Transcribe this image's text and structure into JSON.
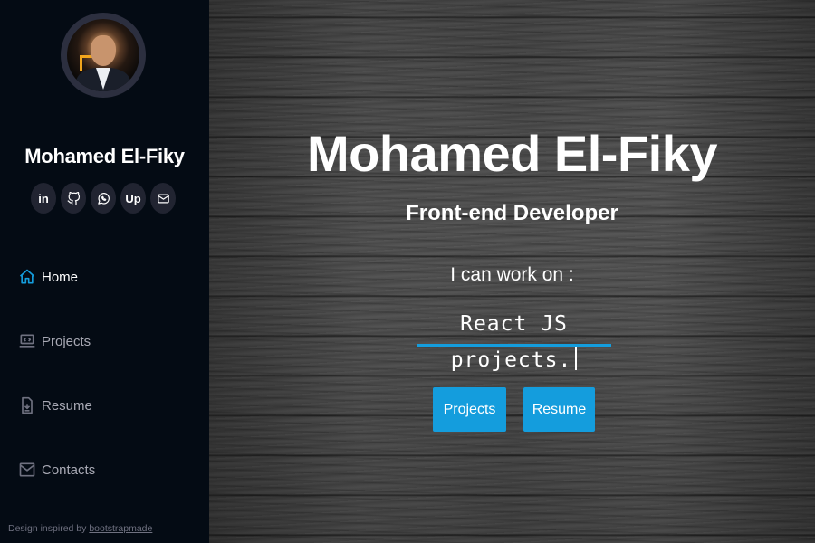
{
  "sidebar": {
    "name": "Mohamed El-Fiky",
    "socials": [
      {
        "icon": "linkedin-icon",
        "label": "in"
      },
      {
        "icon": "github-icon",
        "label": ""
      },
      {
        "icon": "whatsapp-icon",
        "label": ""
      },
      {
        "icon": "upwork-icon",
        "label": "Up"
      },
      {
        "icon": "mail-icon",
        "label": ""
      }
    ],
    "nav": [
      {
        "label": "Home",
        "icon": "house-icon",
        "active": true
      },
      {
        "label": "Projects",
        "icon": "laptop-code-icon",
        "active": false
      },
      {
        "label": "Resume",
        "icon": "file-download-icon",
        "active": false
      },
      {
        "label": "Contacts",
        "icon": "envelope-icon",
        "active": false
      }
    ],
    "credit_prefix": "Design inspired by",
    "credit_link": "bootstrapmade"
  },
  "hero": {
    "title": "Mohamed El-Fiky",
    "role": "Front-end Developer",
    "lead": "I can work on :",
    "typed": "React JS projects.",
    "buttons": {
      "projects": "Projects",
      "resume": "Resume"
    }
  },
  "colors": {
    "accent": "#149ddd",
    "sidebar_bg": "#040b14",
    "social_bg": "#212431",
    "nav_inactive": "#a8a9b4"
  }
}
